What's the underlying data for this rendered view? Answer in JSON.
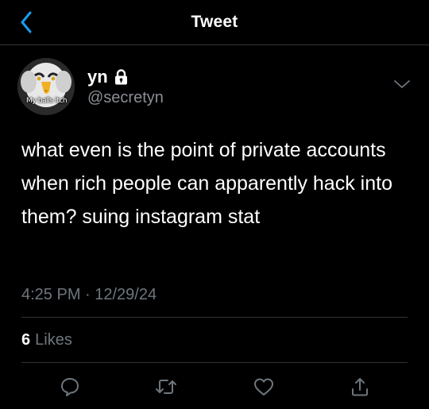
{
  "header": {
    "title": "Tweet",
    "back_icon": "chevron-left-icon"
  },
  "tweet": {
    "author": {
      "display_name": "yn",
      "handle": "@secretyn",
      "avatar_caption": "My balls itch",
      "protected_icon": "lock-icon"
    },
    "text": "what even is the point of private accounts when rich people can apparently hack into them? suing instagram stat",
    "timestamp": "4:25 PM · 12/29/24",
    "likes_count": "6",
    "likes_label": "Likes"
  },
  "actions": [
    "reply-icon",
    "retweet-icon",
    "like-icon",
    "share-icon"
  ],
  "colors": {
    "background": "#000000",
    "accent": "#1d9bf0",
    "secondary_text": "#6e767d",
    "divider": "#2f3336"
  }
}
